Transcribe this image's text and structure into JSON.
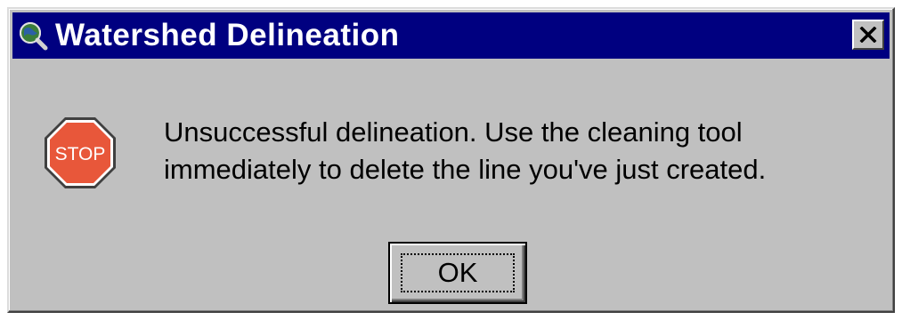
{
  "window": {
    "title": "Watershed Delineation",
    "title_icon": "globe-magnifier-icon",
    "close_icon": "close-icon",
    "title_bar_color": "#000080",
    "face_color": "#c0c0c0"
  },
  "dialog": {
    "icon": "stop-sign-icon",
    "icon_label": "STOP",
    "icon_color": "#e8573a",
    "message_lines": [
      "Unsuccessful delineation.  Use the cleaning tool",
      "immediately to delete the line you've just created."
    ]
  },
  "buttons": {
    "ok_label": "OK"
  }
}
